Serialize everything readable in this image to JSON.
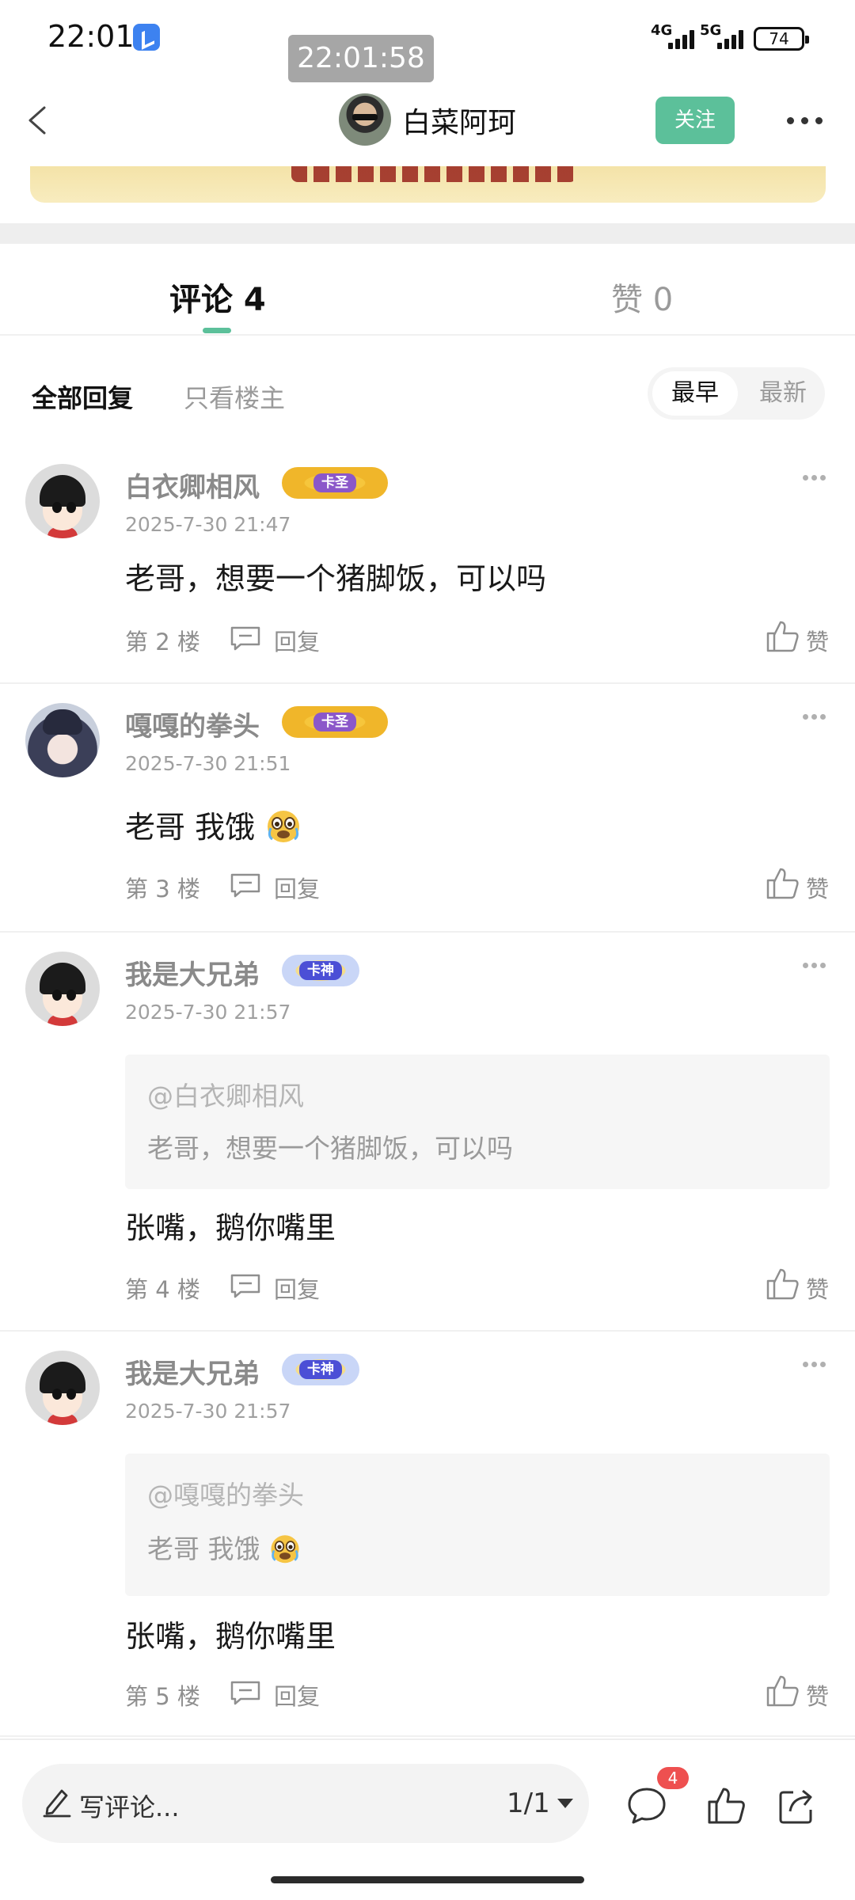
{
  "status_bar": {
    "time": "22:01",
    "overlay_clock": "22:01:58",
    "network_1": "4G",
    "network_2": "5G",
    "battery": "74"
  },
  "header": {
    "author_name": "白菜阿珂",
    "follow_label": "关注"
  },
  "tabs": {
    "comments_label": "评论 4",
    "likes_label": "赞 0"
  },
  "filters": {
    "all_replies": "全部回复",
    "only_op": "只看楼主",
    "sort_earliest": "最早",
    "sort_latest": "最新"
  },
  "comments": [
    {
      "username": "白衣卿相风",
      "badge": "卡圣",
      "timestamp": "2025-7-30 21:47",
      "text": "老哥，想要一个猪脚饭，可以吗",
      "floor": "第 2 楼",
      "reply_label": "回复",
      "like_label": "赞",
      "avatar": "default-cartoon-avatar"
    },
    {
      "username": "嘎嘎的拳头",
      "badge": "卡圣",
      "timestamp": "2025-7-30 21:51",
      "text": "老哥 我饿",
      "emoji": "crying-emoji",
      "floor": "第 3 楼",
      "reply_label": "回复",
      "like_label": "赞",
      "avatar": "anime-avatar"
    },
    {
      "username": "我是大兄弟",
      "badge": "卡神",
      "timestamp": "2025-7-30 21:57",
      "quote_target": "@白衣卿相风",
      "quote_text": "老哥，想要一个猪脚饭，可以吗",
      "text": "张嘴，鹅你嘴里",
      "floor": "第 4 楼",
      "reply_label": "回复",
      "like_label": "赞",
      "avatar": "default-cartoon-avatar"
    },
    {
      "username": "我是大兄弟",
      "badge": "卡神",
      "timestamp": "2025-7-30 21:57",
      "quote_target": "@嘎嘎的拳头",
      "quote_text": "老哥 我饿",
      "text": "张嘴，鹅你嘴里",
      "floor": "第 5 楼",
      "reply_label": "回复",
      "like_label": "赞",
      "avatar": "default-cartoon-avatar"
    }
  ],
  "bottom_bar": {
    "compose_placeholder": "写评论...",
    "page_indicator": "1/1",
    "comment_count": "4"
  },
  "colors": {
    "accent_green": "#5cc09a",
    "badge_red": "#ee5050"
  },
  "icons": [
    "back-icon",
    "more-icon",
    "reply-icon",
    "like-icon",
    "pencil-icon",
    "comment-icon",
    "thumbs-up-icon",
    "share-icon"
  ]
}
